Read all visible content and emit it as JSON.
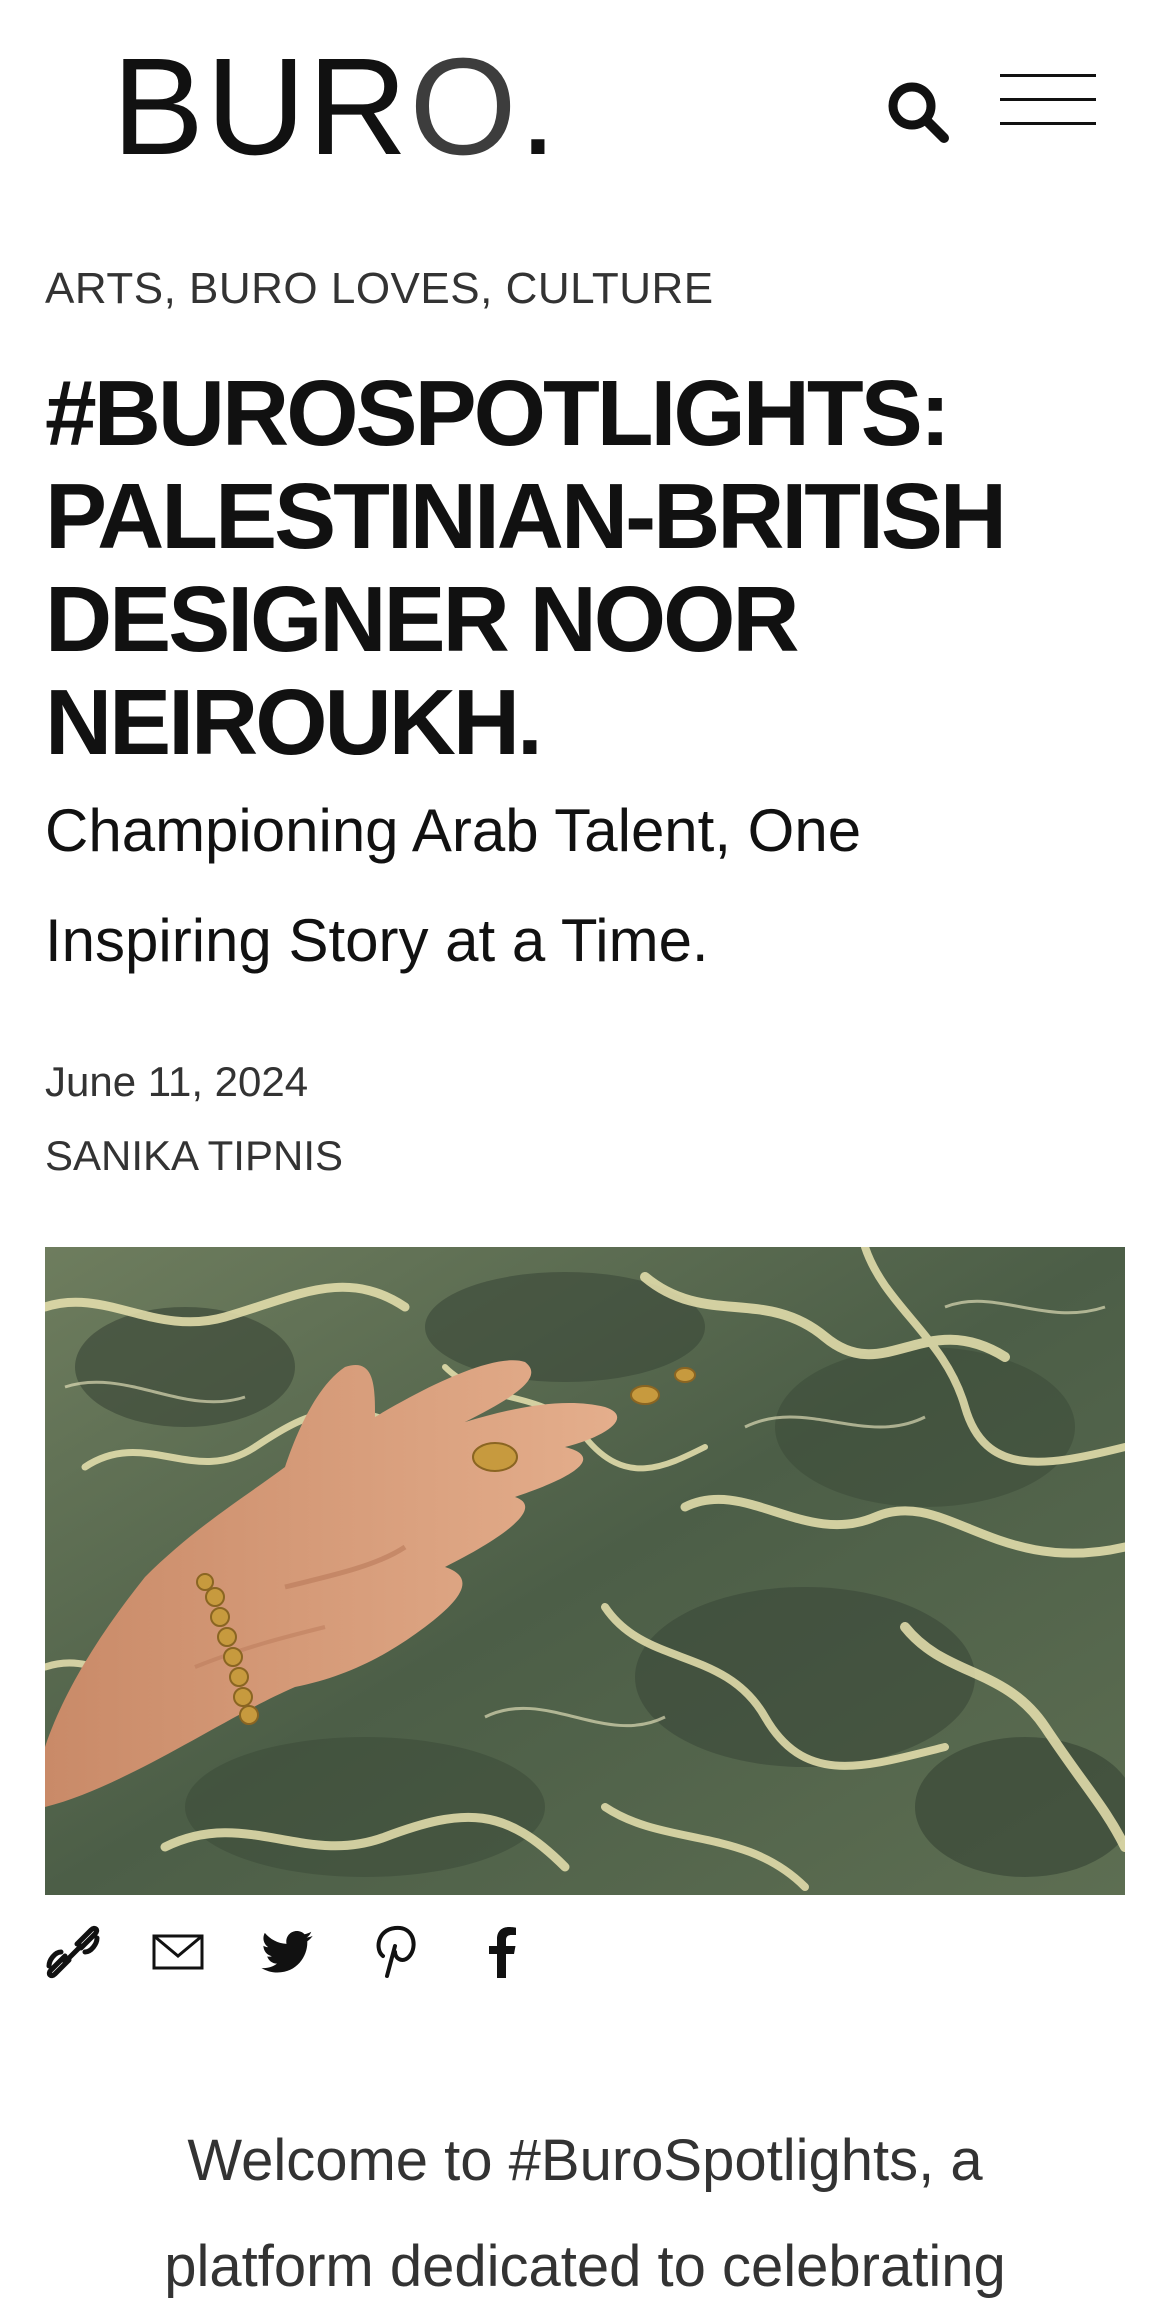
{
  "header": {
    "logo_main": "BUR",
    "logo_o": "O",
    "logo_dot": "."
  },
  "article": {
    "categories": [
      "ARTS",
      "BURO LOVES",
      "CULTURE"
    ],
    "category_separator": ", ",
    "title_lines": [
      "#BUROSPOTLIGHTS:",
      "PALESTINIAN-BRITISH",
      "DESIGNER NOOR",
      "NEIROUKH."
    ],
    "subtitle_lines": [
      "Championing Arab Talent, One",
      "Inspiring Story at a Time."
    ],
    "date": "June 11, 2024",
    "author": "SANIKA TIPNIS",
    "intro_lines": [
      "Welcome to #BuroSpotlights, a",
      "platform dedicated to celebrating"
    ]
  },
  "hero_image": {
    "water_color": "#4c5e47",
    "highlight_color": "#e9e3b0",
    "skin_color": "#d9a07e",
    "gold_color": "#c79a3e"
  },
  "icons": {
    "search": "search-icon",
    "menu": "hamburger-menu-icon",
    "share": [
      "link-icon",
      "email-icon",
      "twitter-icon",
      "pinterest-icon",
      "facebook-icon"
    ]
  }
}
